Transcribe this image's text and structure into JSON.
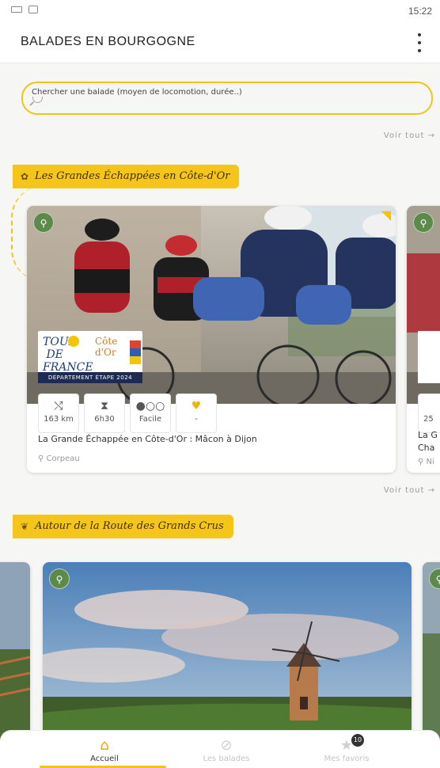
{
  "status_bar": {
    "time": "15:22"
  },
  "header": {
    "title": "BALADES EN BOURGOGNE"
  },
  "search": {
    "label": "Chercher une balade (moyen de locomotion, durée..)",
    "value": ""
  },
  "sections": [
    {
      "title": "Les Grandes Échappées en Côte-d'Or",
      "see_all": "Voir tout →",
      "cards": [
        {
          "title": "La Grande Échappée en Côte-d'Or : Mâcon à Dijon",
          "place": "Corpeau",
          "distance": "163 km",
          "duration": "6h30",
          "difficulty": "Facile",
          "favorite": "-",
          "logo": {
            "tdf": "TOUR DE FRANCE",
            "cote": "Côte d'Or",
            "strip": "DÉPARTEMENT ÉTAPE 2024"
          }
        },
        {
          "title_partial": "La G",
          "title_partial_2": "Cha",
          "place_partial": "Ni",
          "distance_partial": "25"
        }
      ]
    },
    {
      "title": "Autour de la Route des Grands Crus",
      "see_all": "Voir tout →"
    }
  ],
  "top_see_all": "Voir tout →",
  "bottom_nav": [
    {
      "label": "Accueil",
      "icon": "home-icon",
      "active": true
    },
    {
      "label": "Les balades",
      "icon": "compass-icon",
      "active": false
    },
    {
      "label": "Mes favoris",
      "icon": "star-icon",
      "active": false,
      "badge": "10"
    }
  ],
  "colors": {
    "accent": "#f2c417",
    "bike_badge": "#5b8a4a",
    "nav_active": "#f5a300"
  }
}
